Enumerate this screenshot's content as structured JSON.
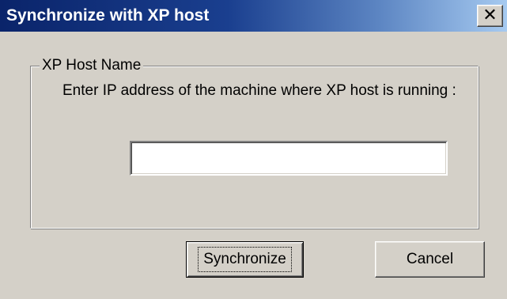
{
  "window": {
    "title": "Synchronize with XP host",
    "close_symbol": "✕"
  },
  "group": {
    "legend": "XP Host Name",
    "instruction": "Enter IP address of the machine where XP host is running :"
  },
  "ip_field": {
    "value": "",
    "placeholder": ""
  },
  "buttons": {
    "synchronize_label": "Synchronize",
    "cancel_label": "Cancel"
  },
  "colors": {
    "face": "#d4d0c8",
    "title_start": "#0a246a",
    "title_end": "#a6caf0"
  },
  "icons": {
    "close": "close-icon"
  }
}
